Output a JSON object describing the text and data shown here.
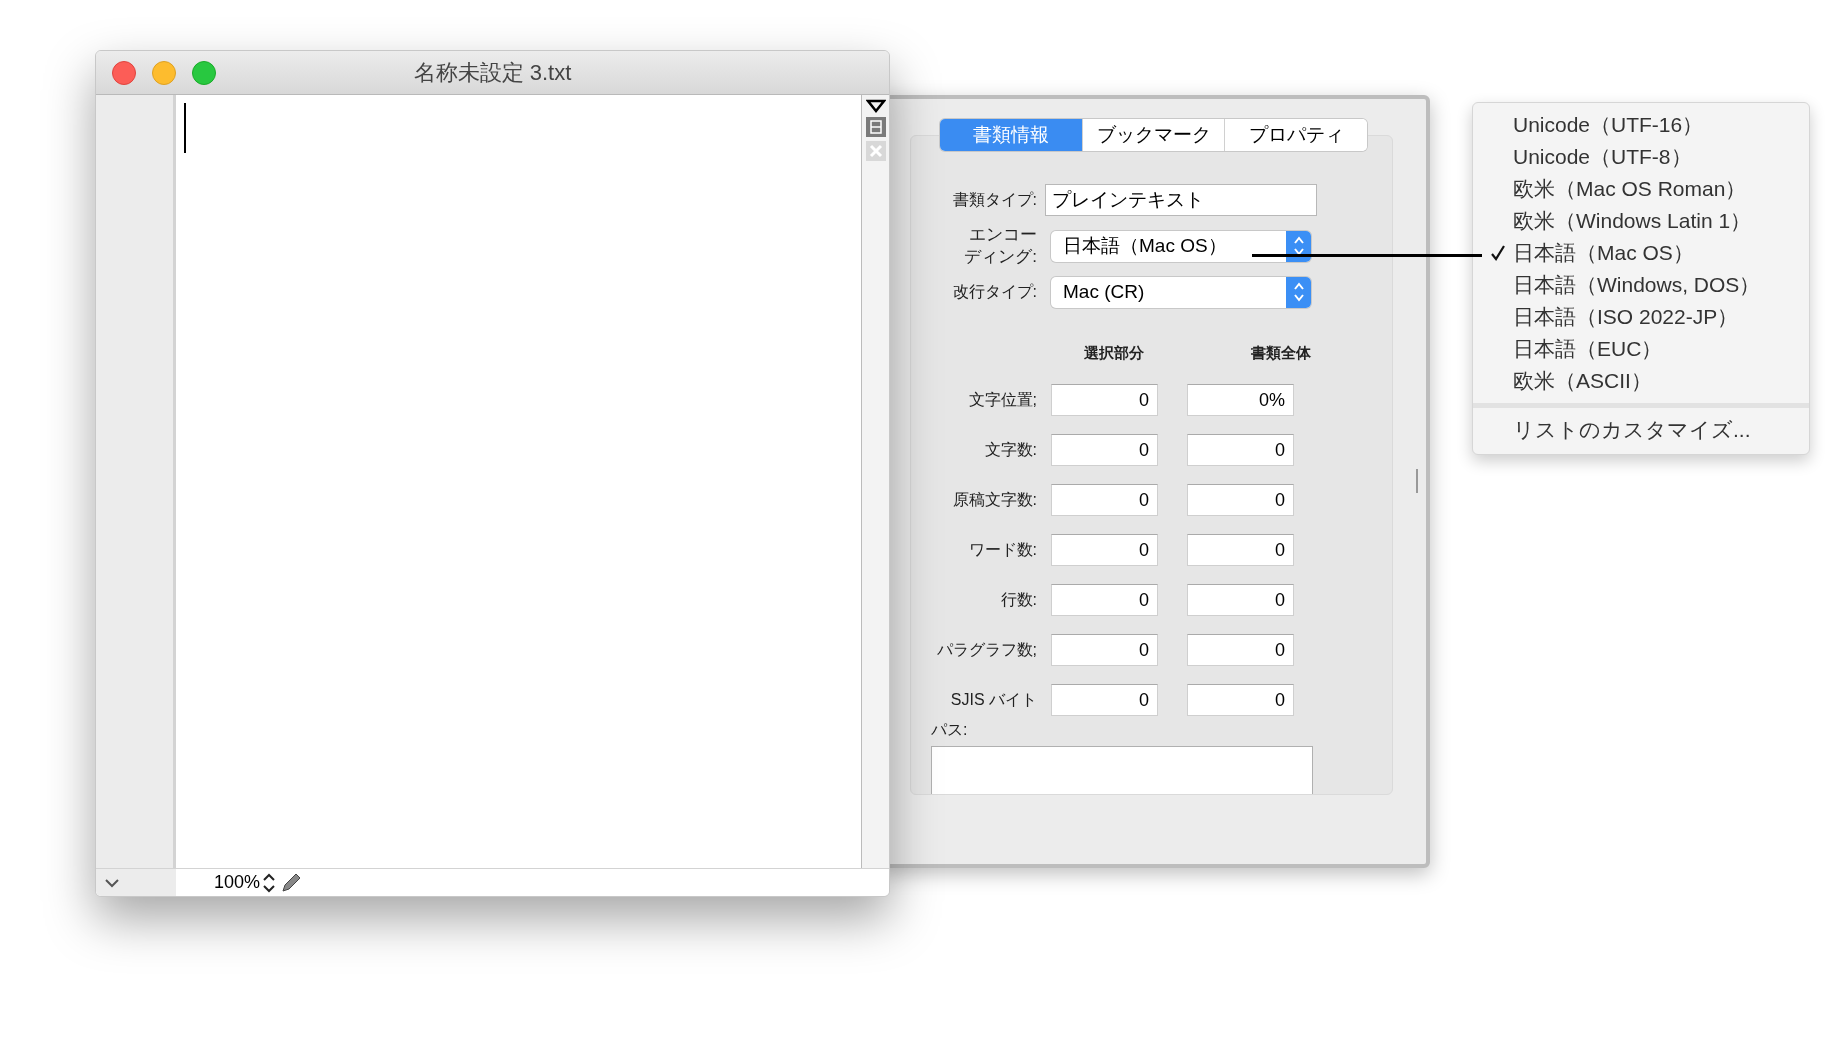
{
  "window": {
    "title": "名称未設定 3.txt",
    "zoom": "100%"
  },
  "drawer": {
    "tabs": [
      {
        "label": "書類情報",
        "selected": true
      },
      {
        "label": "ブックマーク",
        "selected": false
      },
      {
        "label": "プロパティ",
        "selected": false
      }
    ],
    "document_type": {
      "label": "書類タイプ:",
      "value": "プレインテキスト"
    },
    "encoding": {
      "label_lines": [
        "エンコー",
        "ディング:"
      ],
      "value": "日本語（Mac OS）"
    },
    "line_ending": {
      "label": "改行タイプ:",
      "value": "Mac (CR)"
    },
    "columns": [
      "選択部分",
      "書類全体"
    ],
    "rows": [
      {
        "label": "文字位置;",
        "selection": "0",
        "document": "0%"
      },
      {
        "label": "文字数:",
        "selection": "0",
        "document": "0"
      },
      {
        "label": "原稿文字数:",
        "selection": "0",
        "document": "0"
      },
      {
        "label": "ワード数:",
        "selection": "0",
        "document": "0"
      },
      {
        "label": "行数:",
        "selection": "0",
        "document": "0"
      },
      {
        "label": "パラグラフ数;",
        "selection": "0",
        "document": "0"
      },
      {
        "label": "SJIS バイト",
        "selection": "0",
        "document": "0"
      }
    ],
    "path": {
      "label": "パス:"
    }
  },
  "encoding_menu": {
    "items": [
      {
        "label": "Unicode（UTF-16）",
        "checked": false
      },
      {
        "label": "Unicode（UTF-8）",
        "checked": false
      },
      {
        "label": "欧米（Mac OS Roman）",
        "checked": false
      },
      {
        "label": "欧米（Windows Latin 1）",
        "checked": false
      },
      {
        "label": "日本語（Mac OS）",
        "checked": true
      },
      {
        "label": "日本語（Windows, DOS）",
        "checked": false
      },
      {
        "label": "日本語（ISO 2022-JP）",
        "checked": false
      },
      {
        "label": "日本語（EUC）",
        "checked": false
      },
      {
        "label": "欧米（ASCII）",
        "checked": false
      }
    ],
    "customize": "リストのカスタマイズ..."
  }
}
